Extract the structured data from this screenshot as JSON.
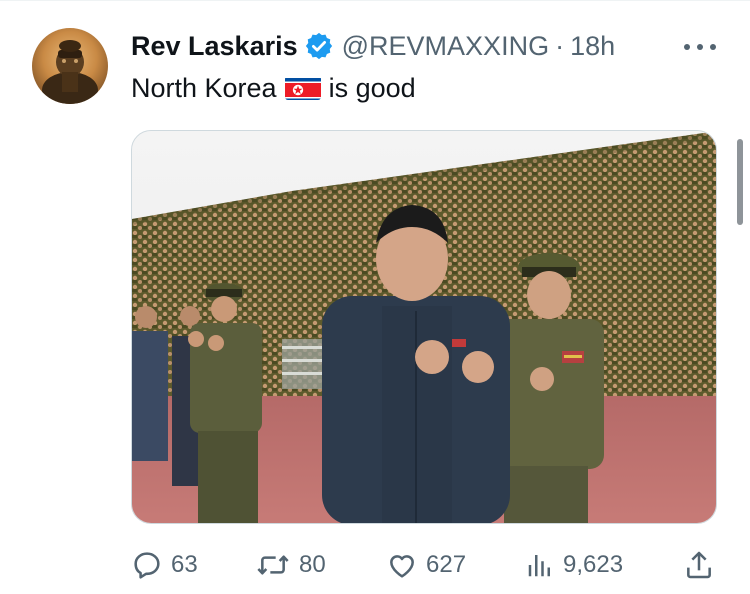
{
  "tweet": {
    "display_name": "Rev Laskaris",
    "handle": "@REVMAXXING",
    "separator": "·",
    "time": "18h",
    "text_before_flag": "North Korea",
    "text_after_flag": "is good",
    "flag_emoji": "north-korea-flag"
  },
  "actions": {
    "replies": "63",
    "reposts": "80",
    "likes": "627",
    "views": "9,623"
  },
  "colors": {
    "verified_blue": "#1d9bf0",
    "muted_text": "#536471",
    "primary_text": "#0f1419"
  },
  "icons": {
    "avatar": "avatar",
    "verified": "verified-badge-icon",
    "more": "more-options-icon",
    "reply": "reply-icon",
    "repost": "repost-icon",
    "like": "like-icon",
    "views": "views-icon",
    "share": "share-icon"
  }
}
